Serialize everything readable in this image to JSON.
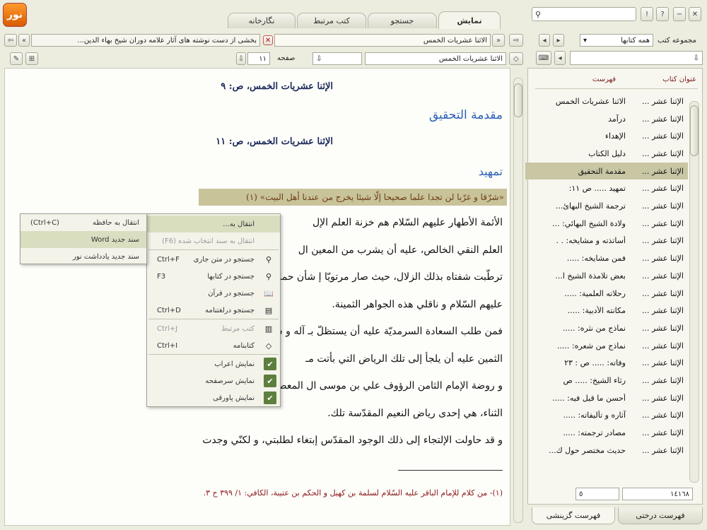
{
  "tabs": [
    "نمایش",
    "جستجو",
    "کتب مرتبط",
    "نگارخانه"
  ],
  "header_right": {
    "label_groups": "مجموعه کتب",
    "groups_value": "همه کتابها",
    "search_placeholder": ""
  },
  "doc_tab": {
    "title": "الاثنا عشريات الخمس",
    "breadcrumb": "بخشی از دست نوشته های آثار علامه دوران شیخ بهاء الدین..."
  },
  "toolbar": {
    "page_label": "صفحه",
    "page_value": "١١",
    "book_field": "الاثنا عشريات الخمس"
  },
  "list": {
    "headers": [
      "عنوان كتاب",
      "فهرست"
    ],
    "rows": [
      [
        "الإثنا عشر ...",
        "الاثنا عشريات الخمس"
      ],
      [
        "الإثنا عشر ...",
        "درآمد"
      ],
      [
        "الإثنا عشر ...",
        "الإهداء"
      ],
      [
        "الإثنا عشر ...",
        "دليل الكتاب"
      ],
      [
        "الإثنا عشر ...",
        "مقدمة التحقيق"
      ],
      [
        "الإثنا عشر ...",
        "تمهيد ..... ص ١١:"
      ],
      [
        "الإثنا عشر ...",
        "ترجمة الشيخ البهائ..."
      ],
      [
        "الإثنا عشر ...",
        "ولادة الشيخ البهائي: ..."
      ],
      [
        "الإثنا عشر ...",
        "أساتذته و مشايخه: . ."
      ],
      [
        "الإثنا عشر ...",
        "فمن مشايخه: ....."
      ],
      [
        "الإثنا عشر ...",
        "بعض تلامذة الشيخ ا..."
      ],
      [
        "الإثنا عشر ...",
        "رحلاته العلمية: ....."
      ],
      [
        "الإثنا عشر ...",
        "مكانته الأدبية: ....."
      ],
      [
        "الإثنا عشر ...",
        "نماذج من نثره: ....."
      ],
      [
        "الإثنا عشر ...",
        "نماذج من شعره: ....."
      ],
      [
        "الإثنا عشر ...",
        "وفاته: ..... ص : ٢٣"
      ],
      [
        "الإثنا عشر ...",
        "رثاء الشيخ: ..... ص"
      ],
      [
        "الإثنا عشر ...",
        "أحسن ما قيل فيه: ....."
      ],
      [
        "الإثنا عشر ...",
        "آثاره و تأليفاته: ....."
      ],
      [
        "الإثنا عشر ...",
        "مصادر ترجمته: ....."
      ],
      [
        "الإثنا عشر ...",
        "حديث مختصر حول ك..."
      ]
    ],
    "selected_index": 4
  },
  "status": {
    "count": "١٤١٦٨",
    "index": "٥"
  },
  "bottom_tabs": [
    "فهرست درختی",
    "فهرست گزینشی"
  ],
  "document": {
    "head1": "الإثنا عشريات الخمس، ص: ٩",
    "section1": "مقدمة التحقيق",
    "head2": "الإثنا عشريات الخمس، ص: ١١",
    "section2": "تمهيد",
    "quote": "«شرّقا و غرّبا لن تجدا علما صحيحا إلّا شيئا يخرج من عندنا أهل البيت» (١)",
    "lines": [
      "الأئمة الأطهار عليهم السّلام هم خزنة العلم الإل",
      "العلم النقي الخالص، عليه أن يشرب من المعين ال",
      "ترطّبت شفتاه بذلك الزلال، حيث صار مرتويّا إ                                  شأن حملة علوم آل محمّد",
      "عليهم السّلام و ناقلي هذه الجواهر الثمينة.",
      "فمن طلب السعادة السرمديّة عليه أن يستظلّ بـ                                  آله و سلّم، و من ابتغى الدر",
      "الثمين عليه أن يلجأ إلى تلك الرياض التي بأتت مـ",
      "و روضة الإمام الثامن الرؤوف علي بن موسى ال                                  المعصومين آلاف التحيّة و",
      "الثناء، هي إحدى رياض النعيم المقدّسة تلك.",
      "و قد حاولت الإلتجاء إلى ذلك الوجود المقدّس إبتغاء لطلبتي، و لكنّي وجدت"
    ],
    "footnote": "(١)- من كلام للإمام الباقر عليه السّلام لسلمة بن كهيل و الحكم بن عتيبة، الكافي: ١/ ٣٩٩ ح ٣."
  },
  "context_menu": {
    "items": [
      {
        "label": "انتقال به...",
        "shortcut": "",
        "icon": "arrow-icon",
        "disabled": false,
        "highlight": true
      },
      {
        "label": "انتقال به سند انتخاب شده (F6)",
        "shortcut": "",
        "icon": "",
        "disabled": true,
        "highlight": false
      },
      {
        "label": "جستجو در متن جاری",
        "shortcut": "Ctrl+F",
        "icon": "magnifier-icon",
        "disabled": false,
        "highlight": false
      },
      {
        "label": "جستجو در کتابها",
        "shortcut": "F3",
        "icon": "magnifier-icon",
        "disabled": false,
        "highlight": false
      },
      {
        "label": "جستجو در قرآن",
        "shortcut": "",
        "icon": "quran-icon",
        "disabled": false,
        "highlight": false
      },
      {
        "label": "جستجو درلغتنامه",
        "shortcut": "Ctrl+D",
        "icon": "dictionary-icon",
        "disabled": false,
        "highlight": false
      },
      {
        "label": "کتب مرتبط",
        "shortcut": "Ctrl+J",
        "icon": "books-icon",
        "disabled": true,
        "highlight": false
      },
      {
        "label": "کتابنامه",
        "shortcut": "Ctrl+I",
        "icon": "bookmark-icon",
        "disabled": false,
        "highlight": false
      },
      {
        "label": "نمایش اعراب",
        "shortcut": "",
        "icon": "check-icon",
        "disabled": false,
        "highlight": false
      },
      {
        "label": "نمایش سرصفحه",
        "shortcut": "",
        "icon": "check-icon",
        "disabled": false,
        "highlight": false
      },
      {
        "label": "نمایش پاورقی",
        "shortcut": "",
        "icon": "check-icon",
        "disabled": false,
        "highlight": false
      }
    ]
  },
  "submenu": {
    "items": [
      {
        "label": "انتقال به حافظه",
        "shortcut": "(Ctrl+C)"
      },
      {
        "label": "سند جدید Word",
        "shortcut": ""
      },
      {
        "label": "سند جدید یادداشت نور",
        "shortcut": ""
      }
    ]
  },
  "colors": {
    "selection": "#c9c6a4",
    "section_blue": "#2c5fb8",
    "quote_bg": "#c9c39a",
    "footnote": "#8b1a1a"
  }
}
